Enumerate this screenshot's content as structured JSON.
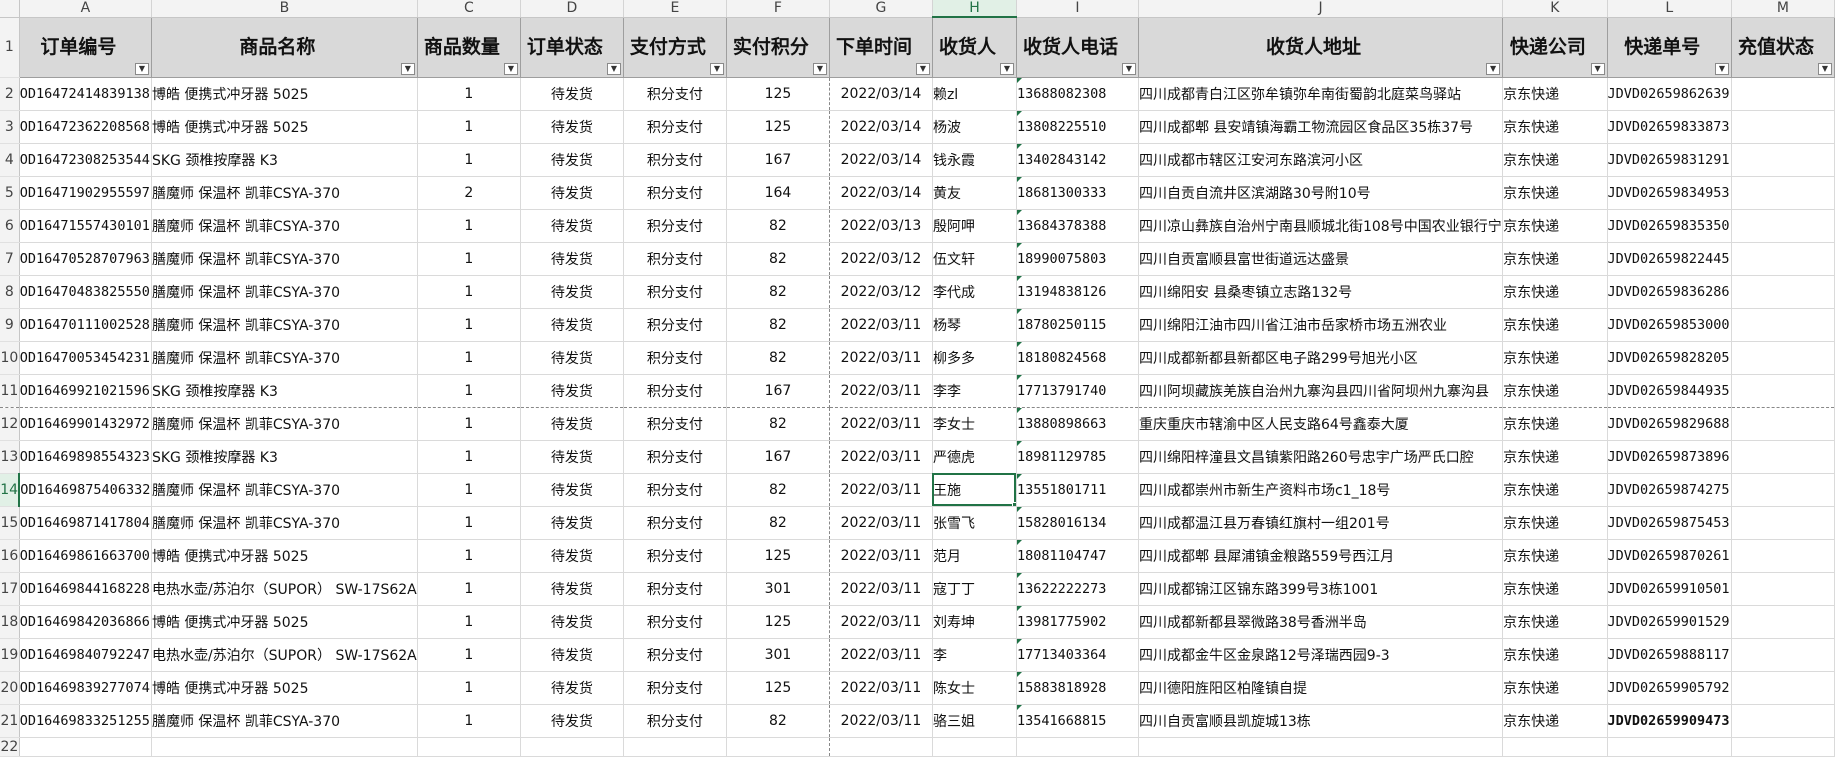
{
  "columns": [
    "A",
    "B",
    "C",
    "D",
    "E",
    "F",
    "G",
    "H",
    "I",
    "J",
    "K",
    "L",
    "M"
  ],
  "selected_column": "H",
  "selected_row": 14,
  "header_row": {
    "row_number": "1",
    "labels": [
      "订单编号",
      "商品名称",
      "商品数量",
      "订单状态",
      "支付方式",
      "实付积分",
      "下单时间",
      "收货人",
      "收货人电话",
      "收货人地址",
      "快递公司",
      "快递单号",
      "充值状态"
    ]
  },
  "rows": [
    {
      "n": "2",
      "cells": [
        "OD16472414839138",
        "博皓 便携式冲牙器 5025",
        "1",
        "待发货",
        "积分支付",
        "125",
        "2022/03/14",
        "赖zl",
        "13688082308",
        "四川成都青白江区弥牟镇弥牟南街蜀韵北庭菜鸟驿站",
        "京东快递",
        "JDVD02659862639",
        ""
      ]
    },
    {
      "n": "3",
      "cells": [
        "OD16472362208568",
        "博皓 便携式冲牙器 5025",
        "1",
        "待发货",
        "积分支付",
        "125",
        "2022/03/14",
        "杨波",
        "13808225510",
        "四川成都郫  县安靖镇海霸工物流园区食品区35栋37号",
        "京东快递",
        "JDVD02659833873",
        ""
      ]
    },
    {
      "n": "4",
      "cells": [
        "OD16472308253544",
        "SKG 颈椎按摩器 K3",
        "1",
        "待发货",
        "积分支付",
        "167",
        "2022/03/14",
        "钱永霞",
        "13402843142",
        "四川成都市辖区江安河东路滨河小区",
        "京东快递",
        "JDVD02659831291",
        ""
      ]
    },
    {
      "n": "5",
      "cells": [
        "OD16471902955597",
        "膳魔师 保温杯 凯菲CSYA-370",
        "2",
        "待发货",
        "积分支付",
        "164",
        "2022/03/14",
        "黄友",
        "18681300333",
        "四川自贡自流井区滨湖路30号附10号",
        "京东快递",
        "JDVD02659834953",
        ""
      ]
    },
    {
      "n": "6",
      "cells": [
        "OD16471557430101",
        "膳魔师 保温杯 凯菲CSYA-370",
        "1",
        "待发货",
        "积分支付",
        "82",
        "2022/03/13",
        "殷阿呷",
        "13684378388",
        "四川凉山彝族自治州宁南县顺城北街108号中国农业银行宁",
        "京东快递",
        "JDVD02659835350",
        ""
      ]
    },
    {
      "n": "7",
      "cells": [
        "OD16470528707963",
        "膳魔师 保温杯 凯菲CSYA-370",
        "1",
        "待发货",
        "积分支付",
        "82",
        "2022/03/12",
        "伍文轩",
        "18990075803",
        "四川自贡富顺县富世街道远达盛景",
        "京东快递",
        "JDVD02659822445",
        ""
      ]
    },
    {
      "n": "8",
      "cells": [
        "OD16470483825550",
        "膳魔师 保温杯 凯菲CSYA-370",
        "1",
        "待发货",
        "积分支付",
        "82",
        "2022/03/12",
        "李代成",
        "13194838126",
        "四川绵阳安  县桑枣镇立志路132号",
        "京东快递",
        "JDVD02659836286",
        ""
      ]
    },
    {
      "n": "9",
      "cells": [
        "OD16470111002528",
        "膳魔师 保温杯 凯菲CSYA-370",
        "1",
        "待发货",
        "积分支付",
        "82",
        "2022/03/11",
        "杨琴",
        "18780250115",
        "四川绵阳江油市四川省江油市岳家桥市场五洲农业",
        "京东快递",
        "JDVD02659853000",
        ""
      ]
    },
    {
      "n": "10",
      "cells": [
        "OD16470053454231",
        "膳魔师 保温杯 凯菲CSYA-370",
        "1",
        "待发货",
        "积分支付",
        "82",
        "2022/03/11",
        "柳多多",
        "18180824568",
        "四川成都新都县新都区电子路299号旭光小区",
        "京东快递",
        "JDVD02659828205",
        ""
      ]
    },
    {
      "n": "11",
      "cells": [
        "OD16469921021596",
        "SKG 颈椎按摩器 K3",
        "1",
        "待发货",
        "积分支付",
        "167",
        "2022/03/11",
        "李李",
        "17713791740",
        "四川阿坝藏族羌族自治州九寨沟县四川省阿坝州九寨沟县",
        "京东快递",
        "JDVD02659844935",
        ""
      ]
    },
    {
      "n": "12",
      "cells": [
        "OD16469901432972",
        "膳魔师 保温杯 凯菲CSYA-370",
        "1",
        "待发货",
        "积分支付",
        "82",
        "2022/03/11",
        "李女士",
        "13880898663",
        "重庆重庆市辖渝中区人民支路64号鑫泰大厦",
        "京东快递",
        "JDVD02659829688",
        ""
      ]
    },
    {
      "n": "13",
      "cells": [
        "OD16469898554323",
        "SKG 颈椎按摩器 K3",
        "1",
        "待发货",
        "积分支付",
        "167",
        "2022/03/11",
        "严德虎",
        "18981129785",
        "四川绵阳梓潼县文昌镇紫阳路260号忠宇广场严氏口腔",
        "京东快递",
        "JDVD02659873896",
        ""
      ]
    },
    {
      "n": "14",
      "cells": [
        "OD16469875406332",
        "膳魔师 保温杯 凯菲CSYA-370",
        "1",
        "待发货",
        "积分支付",
        "82",
        "2022/03/11",
        "王施",
        "13551801711",
        "四川成都崇州市新生产资料市场c1_18号",
        "京东快递",
        "JDVD02659874275",
        ""
      ]
    },
    {
      "n": "15",
      "cells": [
        "OD16469871417804",
        "膳魔师 保温杯 凯菲CSYA-370",
        "1",
        "待发货",
        "积分支付",
        "82",
        "2022/03/11",
        "张雪飞",
        "15828016134",
        "四川成都温江县万春镇红旗村一组201号",
        "京东快递",
        "JDVD02659875453",
        ""
      ]
    },
    {
      "n": "16",
      "cells": [
        "OD16469861663700",
        "博皓 便携式冲牙器 5025",
        "1",
        "待发货",
        "积分支付",
        "125",
        "2022/03/11",
        "范月",
        "18081104747",
        "四川成都郫  县犀浦镇金粮路559号西江月",
        "京东快递",
        "JDVD02659870261",
        ""
      ]
    },
    {
      "n": "17",
      "cells": [
        "OD16469844168228",
        "电热水壶/苏泊尔（SUPOR） SW-17S62A",
        "1",
        "待发货",
        "积分支付",
        "301",
        "2022/03/11",
        "寇丁丁",
        "13622222273",
        "四川成都锦江区锦东路399号3栋1001",
        "京东快递",
        "JDVD02659910501",
        ""
      ]
    },
    {
      "n": "18",
      "cells": [
        "OD16469842036866",
        "博皓 便携式冲牙器 5025",
        "1",
        "待发货",
        "积分支付",
        "125",
        "2022/03/11",
        "刘寿坤",
        "13981775902",
        "四川成都新都县翠微路38号香洲半岛",
        "京东快递",
        "JDVD02659901529",
        ""
      ]
    },
    {
      "n": "19",
      "cells": [
        "OD16469840792247",
        "电热水壶/苏泊尔（SUPOR） SW-17S62A",
        "1",
        "待发货",
        "积分支付",
        "301",
        "2022/03/11",
        "李",
        "17713403364",
        "四川成都金牛区金泉路12号泽瑞西园9-3",
        "京东快递",
        "JDVD02659888117",
        ""
      ]
    },
    {
      "n": "20",
      "cells": [
        "OD16469839277074",
        "博皓 便携式冲牙器 5025",
        "1",
        "待发货",
        "积分支付",
        "125",
        "2022/03/11",
        "陈女士",
        "15883818928",
        "四川德阳旌阳区柏隆镇自提",
        "京东快递",
        "JDVD02659905792",
        ""
      ]
    },
    {
      "n": "21",
      "cells": [
        "OD16469833251255",
        "膳魔师 保温杯 凯菲CSYA-370",
        "1",
        "待发货",
        "积分支付",
        "82",
        "2022/03/11",
        "骆三姐",
        "13541668815",
        "四川自贡富顺县凯旋城13栋",
        "京东快递",
        "JDVD02659909473",
        ""
      ]
    },
    {
      "n": "22",
      "cells": [
        "",
        "",
        "",
        "",
        "",
        "",
        "",
        "",
        "",
        "",
        "",
        "",
        ""
      ]
    }
  ],
  "filter_button_icon": "dropdown-filter-icon",
  "colors": {
    "header_fill": "#d9d9d9",
    "selection": "#217346",
    "gridline": "#dadada"
  }
}
